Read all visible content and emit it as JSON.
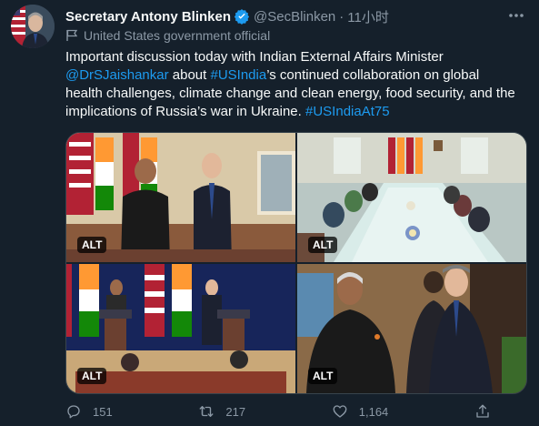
{
  "tweet": {
    "author_name": "Secretary Antony Blinken",
    "handle": "@SecBlinken",
    "separator": "·",
    "time": "11小时",
    "label": "United States government official",
    "text_segments": [
      {
        "text": "Important discussion today with Indian External Affairs Minister ",
        "link": false
      },
      {
        "text": "@DrSJaishankar",
        "link": true
      },
      {
        "text": " about ",
        "link": false
      },
      {
        "text": "#USIndia",
        "link": true
      },
      {
        "text": "’s continued collaboration on global health challenges, climate change and clean energy, food security, and the implications of Russia’s war in Ukraine. ",
        "link": false
      },
      {
        "text": "#USIndiaAt75",
        "link": true
      }
    ],
    "media": [
      {
        "name": "photo-two-officials-standing",
        "alt_badge": "ALT"
      },
      {
        "name": "photo-meeting-table",
        "alt_badge": "ALT"
      },
      {
        "name": "photo-press-podiums",
        "alt_badge": "ALT"
      },
      {
        "name": "photo-walking-corridor",
        "alt_badge": "ALT"
      }
    ],
    "actions": {
      "reply_count": "151",
      "retweet_count": "217",
      "like_count": "1,164"
    }
  },
  "colors": {
    "background": "#15202b",
    "text": "#f7f9f9",
    "muted": "#8b98a5",
    "link": "#1d9bf0",
    "verified": "#1d9bf0"
  }
}
